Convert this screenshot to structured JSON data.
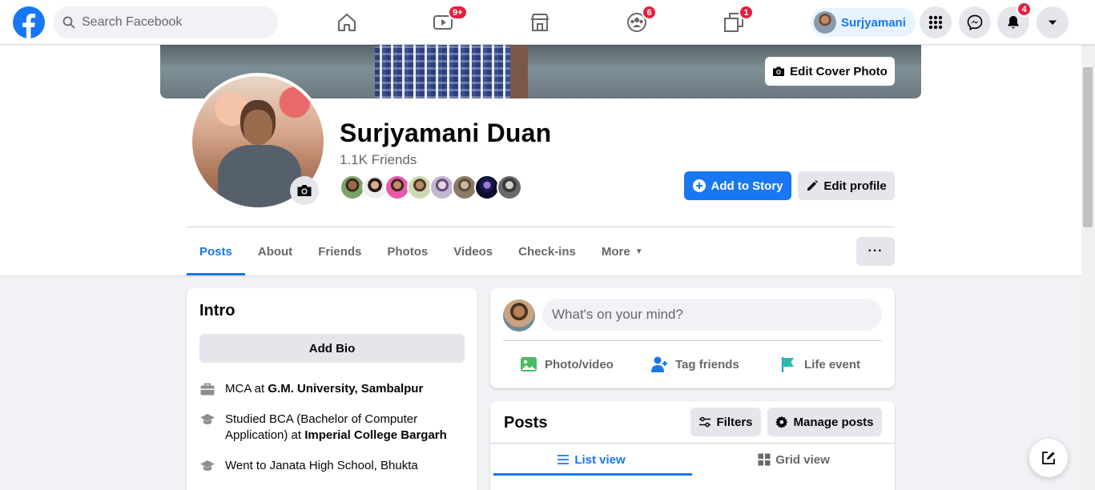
{
  "search": {
    "placeholder": "Search Facebook"
  },
  "nav": {
    "watch_badge": "9+",
    "groups_badge": "6",
    "gaming_badge": "1",
    "profile_name": "Surjyamani",
    "notifications_badge": "4"
  },
  "cover": {
    "edit_label": "Edit Cover Photo"
  },
  "profile": {
    "name": "Surjyamani Duan",
    "friends": "1.1K Friends",
    "add_story_label": "Add to Story",
    "edit_profile_label": "Edit profile"
  },
  "tabs": {
    "items": [
      "Posts",
      "About",
      "Friends",
      "Photos",
      "Videos",
      "Check-ins",
      "More"
    ],
    "more_dots": "···"
  },
  "intro": {
    "title": "Intro",
    "add_bio": "Add Bio",
    "items": [
      {
        "prefix": "MCA at ",
        "bold": "G.M. University, Sambalpur",
        "icon": "briefcase-icon"
      },
      {
        "prefix": "Studied BCA (Bachelor of Computer Application) at ",
        "bold": "Imperial College Bargarh",
        "icon": "graduation-cap-icon"
      },
      {
        "prefix": "Went to Janata High School, Bhukta",
        "bold": "",
        "icon": "graduation-cap-icon"
      }
    ]
  },
  "composer": {
    "placeholder": "What's on your mind?",
    "photo_video": "Photo/video",
    "tag_friends": "Tag friends",
    "life_event": "Life event"
  },
  "posts": {
    "title": "Posts",
    "filters": "Filters",
    "manage": "Manage posts",
    "list_view": "List view",
    "grid_view": "Grid view"
  },
  "colors": {
    "brand": "#1877f2",
    "badge": "#e41e3f",
    "background": "#f0f2f5",
    "secondary_button": "#e4e6eb",
    "muted_text": "#65676b"
  }
}
